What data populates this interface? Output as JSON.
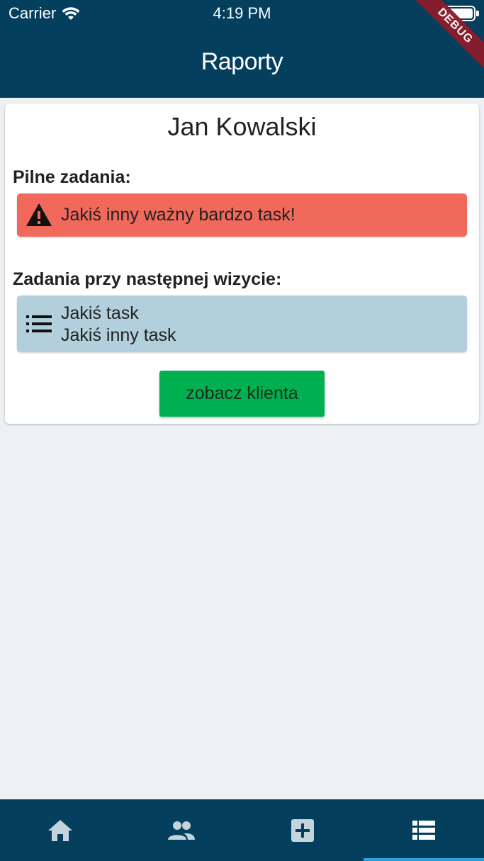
{
  "status_bar": {
    "carrier": "Carrier",
    "time": "4:19 PM",
    "debug_banner": "DEBUG"
  },
  "app_bar": {
    "title": "Raporty"
  },
  "card": {
    "client_name": "Jan Kowalski",
    "urgent_label": "Pilne zadania:",
    "urgent_task": "Jakiś inny ważny bardzo task!",
    "next_visit_label": "Zadania przy następnej wizycie:",
    "next_visit_tasks": [
      "Jakiś task",
      "Jakiś inny task"
    ],
    "button_label": "zobacz klienta"
  },
  "bottom_nav": {
    "items": [
      {
        "icon": "home-icon",
        "active": false
      },
      {
        "icon": "people-icon",
        "active": false
      },
      {
        "icon": "add-box-icon",
        "active": false
      },
      {
        "icon": "list-view-icon",
        "active": true
      }
    ],
    "active_color": "#2aa3e6",
    "icon_color": "#c5d3dc"
  },
  "colors": {
    "app_bar": "#043f5d",
    "urgent_bg": "#f0695b",
    "tasks_bg": "#b2cfdb",
    "button_bg": "#00b050",
    "page_bg": "#eef1f3"
  }
}
